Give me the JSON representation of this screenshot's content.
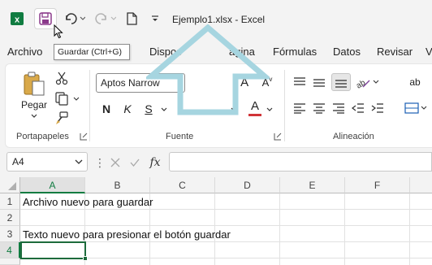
{
  "titlebar": {
    "title": "Ejemplo1.xlsx  -  Excel",
    "icons": [
      "excel-logo-icon",
      "save-icon",
      "undo-icon",
      "redo-icon",
      "new-file-icon",
      "customize-qat-icon"
    ]
  },
  "tooltip": {
    "text": "Guardar (Ctrl+G)"
  },
  "tabs": [
    {
      "label": "Archivo"
    },
    {
      "label": "Dispos"
    },
    {
      "label": "ágina"
    },
    {
      "label": "Fórmulas"
    },
    {
      "label": "Datos"
    },
    {
      "label": "Revisar"
    },
    {
      "label": "V"
    }
  ],
  "ribbon": {
    "portapapeles": {
      "paste_label": "Pegar",
      "group_label": "Portapapeles"
    },
    "fuente": {
      "font_name": "Aptos Narrow",
      "bold": "N",
      "italic": "K",
      "underline": "S",
      "grow": "A",
      "shrink": "A",
      "font_color": "A",
      "group_label": "Fuente"
    },
    "alineacion": {
      "group_label": "Alineación",
      "wrap_label": "ab"
    }
  },
  "formula_bar": {
    "name_box": "A4",
    "fx": "fx",
    "value": ""
  },
  "sheet": {
    "columns": [
      "A",
      "B",
      "C",
      "D",
      "E",
      "F"
    ],
    "rows": [
      "1",
      "2",
      "3",
      "4"
    ],
    "cells": {
      "A1": "Archivo nuevo para guardar",
      "A2": "",
      "A3": "Texto nuevo para presionar el botón guardar",
      "A4": ""
    },
    "active_cell": "A4"
  },
  "colors": {
    "excel_green": "#107c41",
    "active_border": "#1d6b3c",
    "arrow": "#a6d5e0",
    "font_color_bar": "#d13438"
  }
}
